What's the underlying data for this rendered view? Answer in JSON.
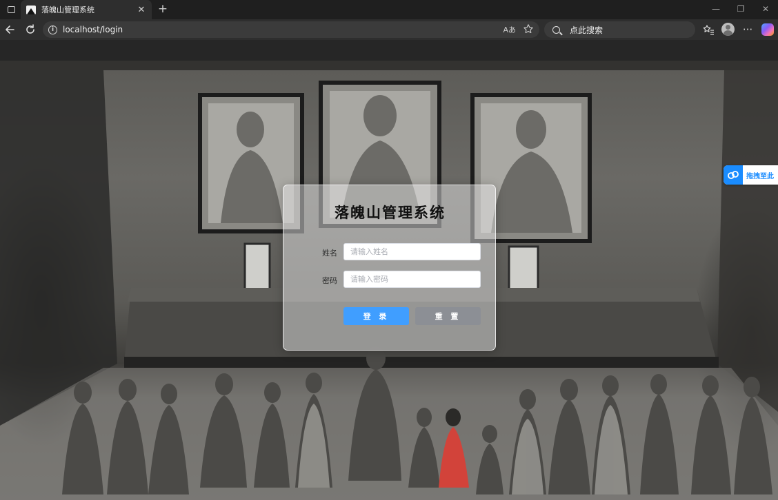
{
  "browser": {
    "tab": {
      "title": "落魄山管理系统",
      "close": "✕"
    },
    "new_tab": "+",
    "window": {
      "minimize": "—",
      "restore": "❐",
      "close": "✕"
    },
    "address": {
      "url": "localhost/login",
      "read_aloud": "Aあ"
    },
    "search": {
      "placeholder": "点此搜索"
    },
    "more": "···"
  },
  "side_widget": {
    "label": "拖拽至此"
  },
  "login": {
    "title": "落魄山管理系统",
    "name_label": "姓名",
    "name_placeholder": "请输入姓名",
    "password_label": "密码",
    "password_placeholder": "请输入密码",
    "login_button": "登 录",
    "reset_button": "重 置"
  },
  "colors": {
    "primary": "#409eff",
    "reset": "#8c8f95",
    "widget": "#1a8cff"
  }
}
